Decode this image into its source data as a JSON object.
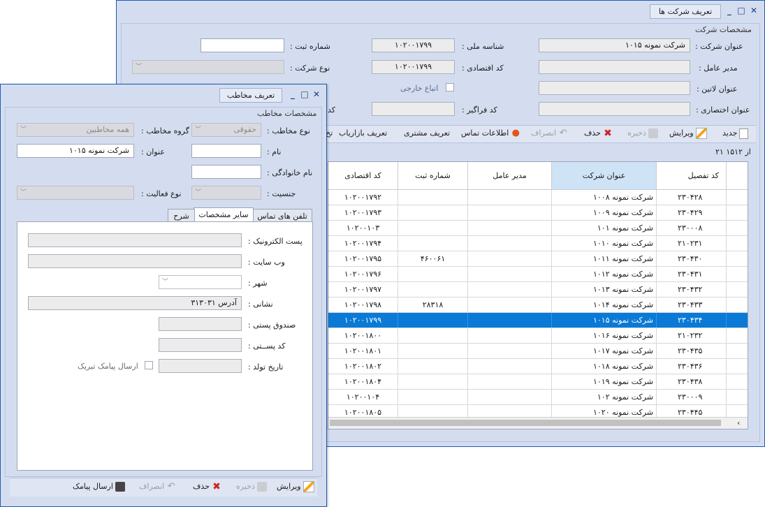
{
  "company_window": {
    "title": "تعریف شرکت ها",
    "group_title": "مشخصات شرکت",
    "fields": {
      "company_title_label": "عنوان شرکت :",
      "company_title_value": "شرکت نمونه ۱۰۱۵",
      "national_id_label": "شناسه ملی :",
      "national_id_value": "۱۰۲۰۰۱۷۹۹",
      "reg_no_label": "شماره ثبت :",
      "reg_no_value": "",
      "ceo_label": "مدیر عامل :",
      "ceo_value": "",
      "economic_code_label": "کد اقتصادی :",
      "economic_code_value": "۱۰۲۰۰۱۷۹۹",
      "company_type_label": "نوع شرکت :",
      "latin_title_label": "عنوان لاتین :",
      "latin_title_value": "",
      "foreign_label": "اتباع خارجی",
      "short_title_label": "عنوان اختصاری :",
      "short_title_value": "",
      "comprehensive_code_label": "کد فراگیر :",
      "comprehensive_code_value": "",
      "hidden_code_label": "کد"
    },
    "toolbar": {
      "new": "جدید",
      "edit": "ویرایش",
      "save": "ذخیره",
      "delete": "حذف",
      "cancel": "انصراف",
      "contact_info": "اطلاعات تماس",
      "define_customer": "تعریف مشتری",
      "define_marketer": "تعریف بازاریاب",
      "truncated": "تخ"
    },
    "pager": "از ۱۵۱۲ ۲۱",
    "grid": {
      "columns": [
        "کد تفصیل",
        "عنوان شرکت",
        "مدیر عامل",
        "شماره ثبت",
        "کد اقتصادی"
      ],
      "rows": [
        [
          "۲۳۰۴۲۸",
          "شرکت نمونه ۱۰۰۸",
          "",
          "",
          "۱۰۲۰۰۱۷۹۲"
        ],
        [
          "۲۳۰۴۲۹",
          "شرکت نمونه ۱۰۰۹",
          "",
          "",
          "۱۰۲۰۰۱۷۹۳"
        ],
        [
          "۲۳۰۰۰۸",
          "شرکت نمونه ۱۰۱",
          "",
          "",
          "۱۰۲۰۰۱۰۳"
        ],
        [
          "۲۱۰۲۳۱",
          "شرکت نمونه ۱۰۱۰",
          "",
          "",
          "۱۰۲۰۰۱۷۹۴"
        ],
        [
          "۲۳۰۴۳۰",
          "شرکت نمونه ۱۰۱۱",
          "",
          "۴۶۰۰۶۱",
          "۱۰۲۰۰۱۷۹۵"
        ],
        [
          "۲۳۰۴۳۱",
          "شرکت نمونه ۱۰۱۲",
          "",
          "",
          "۱۰۲۰۰۱۷۹۶"
        ],
        [
          "۲۳۰۴۳۲",
          "شرکت نمونه ۱۰۱۳",
          "",
          "",
          "۱۰۲۰۰۱۷۹۷"
        ],
        [
          "۲۳۰۴۳۳",
          "شرکت نمونه ۱۰۱۴",
          "",
          "۲۸۳۱۸",
          "۱۰۲۰۰۱۷۹۸"
        ],
        [
          "۲۳۰۴۳۴",
          "شرکت نمونه ۱۰۱۵",
          "",
          "",
          "۱۰۲۰۰۱۷۹۹"
        ],
        [
          "۲۱۰۲۳۲",
          "شرکت نمونه ۱۰۱۶",
          "",
          "",
          "۱۰۲۰۰۱۸۰۰"
        ],
        [
          "۲۳۰۴۳۵",
          "شرکت نمونه ۱۰۱۷",
          "",
          "",
          "۱۰۲۰۰۱۸۰۱"
        ],
        [
          "۲۳۰۴۳۶",
          "شرکت نمونه ۱۰۱۸",
          "",
          "",
          "۱۰۲۰۰۱۸۰۲"
        ],
        [
          "۲۳۰۴۳۸",
          "شرکت نمونه ۱۰۱۹",
          "",
          "",
          "۱۰۲۰۰۱۸۰۴"
        ],
        [
          "۲۳۰۰۰۹",
          "شرکت نمونه ۱۰۲",
          "",
          "",
          "۱۰۲۰۰۱۰۴"
        ],
        [
          "۲۳۰۴۴۵",
          "شرکت نمونه ۱۰۲۰",
          "",
          "",
          "۱۰۲۰۰۱۸۰۵"
        ]
      ],
      "selected_row": 8
    }
  },
  "contact_window": {
    "title": "تعریف مخاطب",
    "group_title": "مشخصات مخاطب",
    "fields": {
      "contact_type_label": "نوع مخاطب :",
      "contact_type_value": "حقوقی",
      "contact_group_label": "گروه مخاطب :",
      "contact_group_value": "همه مخاطبین",
      "name_label": "نام :",
      "name_value": "",
      "title_label": "عنوان :",
      "title_value": "شرکت نمونه ۱۰۱۵",
      "family_label": "نام خانوادگی :",
      "family_value": "",
      "gender_label": "جنسیت :",
      "activity_type_label": "نوع فعالیت :"
    },
    "tabs": [
      "تلفن های تماس",
      "سایر مشخصات",
      "شرح"
    ],
    "active_tab": 1,
    "other_info": {
      "email_label": "پست الکترونیک :",
      "email_value": "",
      "website_label": "وب سایت :",
      "website_value": "",
      "city_label": "شهر :",
      "city_value": "",
      "address_label": "نشانی :",
      "address_value": "آدرس ۳۱۳۰۳۱",
      "pobox_label": "صندوق پستی :",
      "pobox_value": "",
      "postal_label": "کد پســتی :",
      "postal_value": "",
      "birthdate_label": "تاریخ تولد :",
      "birthdate_value": "",
      "sms_label": "ارسال پیامک تبریک"
    },
    "footer": {
      "edit": "ویرایش",
      "save": "ذخیره",
      "delete": "حذف",
      "cancel": "انصراف",
      "send_sms": "ارسال پیامک"
    }
  }
}
